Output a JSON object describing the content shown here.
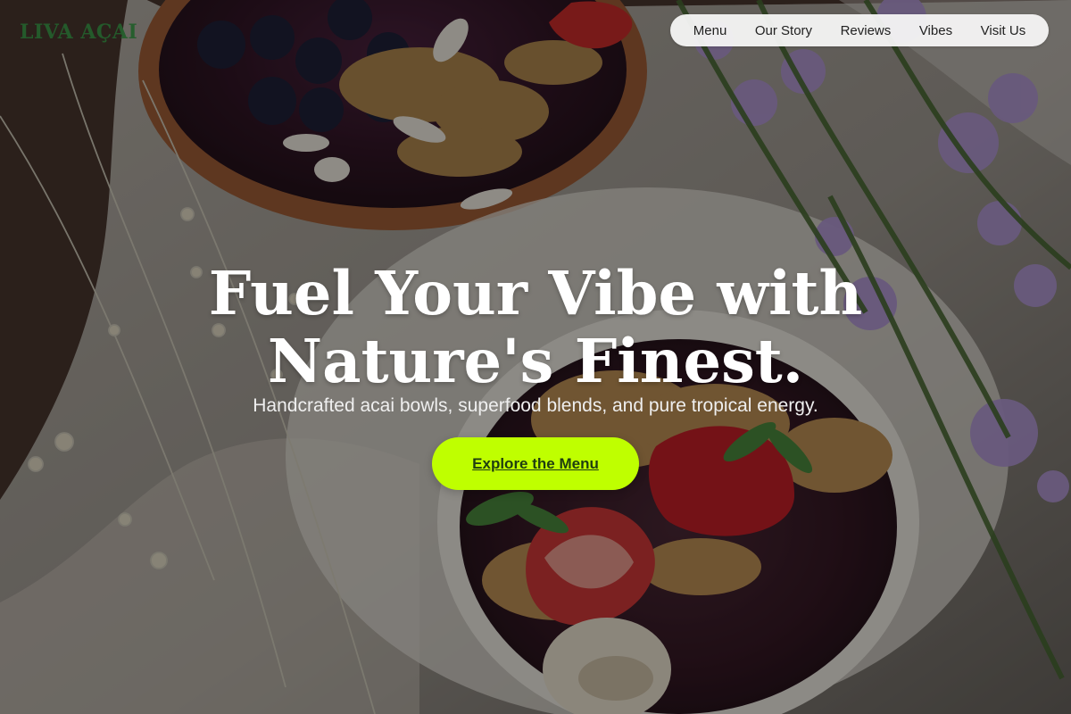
{
  "brand": {
    "logo_text": "LIVA AÇAI",
    "accent_color": "#bfff00"
  },
  "navigation": {
    "items": [
      {
        "label": "Menu"
      },
      {
        "label": "Our Story"
      },
      {
        "label": "Reviews"
      },
      {
        "label": "Vibes"
      },
      {
        "label": "Visit Us"
      }
    ]
  },
  "hero": {
    "headline_line1": "Fuel Your Vibe with",
    "headline_line2": "Nature's Finest.",
    "subheadline": "Handcrafted acai bowls, superfood blends, and pure tropical energy.",
    "cta_label": "Explore the Menu"
  }
}
